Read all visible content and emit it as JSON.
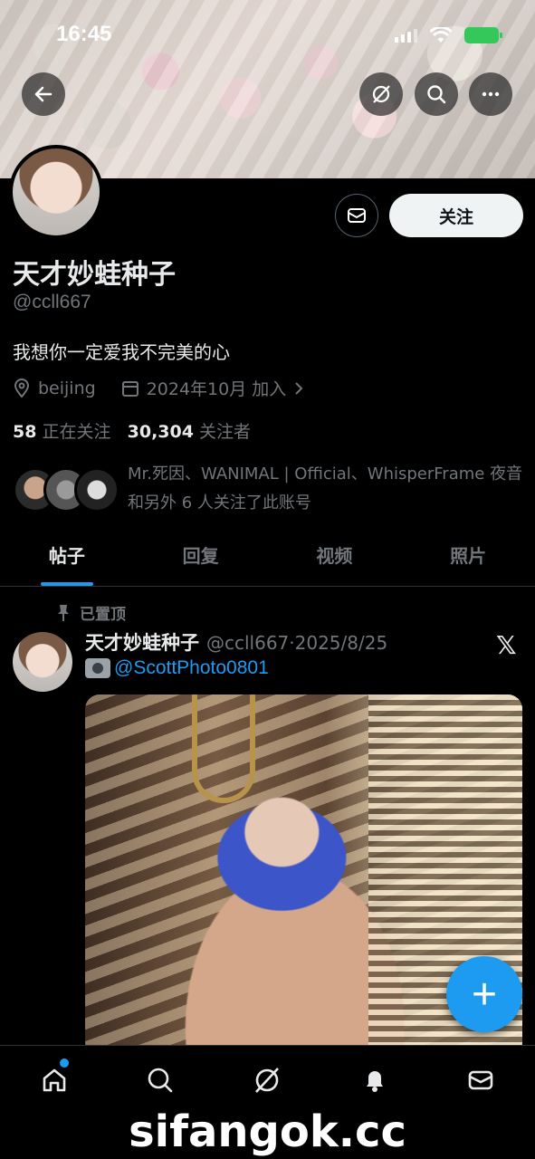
{
  "status_bar": {
    "time": "16:45"
  },
  "profile": {
    "name": "天才妙蛙种子",
    "handle": "@ccll667",
    "bio": "我想你一定爱我不完美的心",
    "location": "beijing",
    "joined": "2024年10月 加入",
    "following_count": "58",
    "following_label": "正在关注",
    "followers_count": "30,304",
    "followers_label": "关注者",
    "followed_by_text": "Mr.死因、WANIMAL | Official、WhisperFrame 夜音 和另外 6 人关注了此账号",
    "follow_button_label": "关注"
  },
  "tabs": [
    {
      "label": "帖子",
      "active": true
    },
    {
      "label": "回复",
      "active": false
    },
    {
      "label": "视频",
      "active": false
    },
    {
      "label": "照片",
      "active": false
    }
  ],
  "post": {
    "pinned_label": "已置顶",
    "author_name": "天才妙蛙种子",
    "author_meta": "@ccll667·2025/8/25",
    "text": "@ScottPhoto0801",
    "x_logo": "𝕏"
  },
  "fab_label": "+",
  "watermark": "sifangok.cc",
  "colors": {
    "accent": "#1d9bf0",
    "background": "#000000",
    "muted": "#71767b",
    "text": "#e7e9ea"
  }
}
